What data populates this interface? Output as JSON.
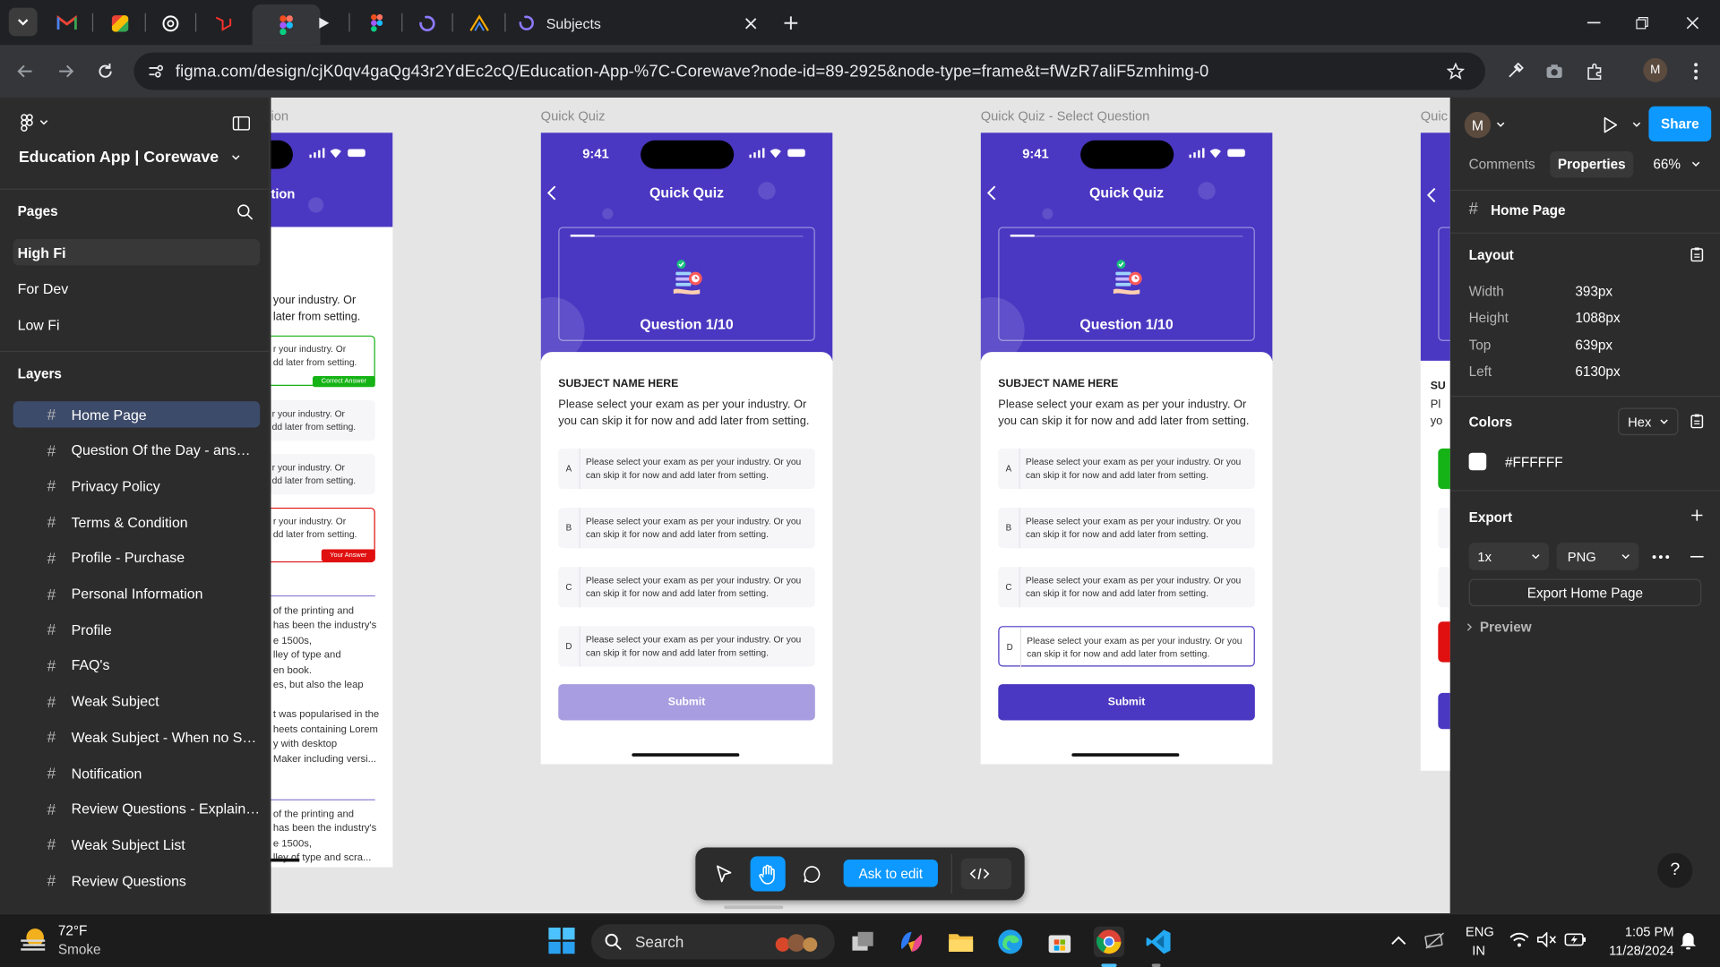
{
  "browser": {
    "active_tab_title": "Subjects",
    "url": "figma.com/design/cjK0qv4gaQg43r2YdEc2cQ/Education-App-%7C-Corewave?node-id=89-2925&node-type=frame&t=fWzR7aliF5zmhimg-0",
    "profile_initial": "M"
  },
  "left_panel": {
    "file_name": "Education App | Corewave",
    "pages_title": "Pages",
    "pages": [
      "High Fi",
      "For Dev",
      "Low Fi"
    ],
    "layers_title": "Layers",
    "layers": [
      "Home Page",
      "Question Of the Day - answer ...",
      "Privacy Policy",
      "Terms & Condition",
      "Profile - Purchase",
      "Personal Information",
      "Profile",
      "FAQ's",
      "Weak Subject",
      "Weak Subject - When no Subj...",
      "Notification",
      "Review Questions - Explainati...",
      "Weak Subject List",
      "Review Questions"
    ]
  },
  "canvas": {
    "partial_left_label": "ion",
    "partial_left_title": "tion",
    "partial_left": {
      "line1": "your industry. Or",
      "line2": "later from setting.",
      "card_a1": "r your industry. Or",
      "card_a2": "dd later from setting.",
      "correct": "Correct Answer",
      "card_b1": "r your industry. Or",
      "card_b2": "dd later from setting.",
      "card_c1": "r your industry. Or",
      "card_c2": "dd later from setting.",
      "card_d1": "r your industry. Or",
      "card_d2": "dd later from setting.",
      "your_answer": "Your Answer",
      "p1": "of the printing and",
      "p2": "has been the industry's",
      "p3": "e 1500s,",
      "p4": "lley of type and",
      "p5": "en book.",
      "p6": "es, but also the leap",
      "p7": "t was popularised in the",
      "p8": "heets containing Lorem",
      "p9": "y with desktop",
      "p10": "Maker including versi...",
      "p11": "of the printing and",
      "p12": "has been the industry's",
      "p13": "e 1500s,",
      "p14": "lley of type and scra..."
    },
    "frame1_label": "Quick Quiz",
    "frame2_label": "Quick Quiz - Select Question",
    "frame3_label": "Quic",
    "frame3_text1": "SU",
    "frame3_text2": "Pl",
    "frame3_text3": "yo",
    "phone": {
      "time": "9:41",
      "title": "Quick Quiz",
      "question_label": "Question 1/10",
      "subject": "SUBJECT NAME HERE",
      "description": "Please select your exam as per your industry. Or you can skip it for now and add later from setting.",
      "options": [
        {
          "letter": "A",
          "text": "Please select your exam as per your industry. Or you can skip it for now and add later from setting."
        },
        {
          "letter": "B",
          "text": "Please select your exam as per your industry. Or you can skip it for now and add later from setting."
        },
        {
          "letter": "C",
          "text": "Please select your exam as per your industry. Or you can skip it for now and add later from setting."
        },
        {
          "letter": "D",
          "text": "Please select your exam as per your industry. Or you can skip it for now and add later from setting."
        }
      ],
      "submit": "Submit"
    },
    "toolbar": {
      "ask_to_edit": "Ask to edit"
    }
  },
  "right_panel": {
    "avatar": "M",
    "share": "Share",
    "tab_comments": "Comments",
    "tab_properties": "Properties",
    "zoom": "66%",
    "frame_name": "Home Page",
    "layout_title": "Layout",
    "width_label": "Width",
    "width_value": "393px",
    "height_label": "Height",
    "height_value": "1088px",
    "top_label": "Top",
    "top_value": "639px",
    "left_label": "Left",
    "left_value": "6130px",
    "colors_title": "Colors",
    "color_format": "Hex",
    "color_value": "#FFFFFF",
    "export_title": "Export",
    "export_scale": "1x",
    "export_format": "PNG",
    "export_button": "Export Home Page",
    "preview": "Preview",
    "help": "?"
  },
  "taskbar": {
    "weather_temp": "72°F",
    "weather_desc": "Smoke",
    "search": "Search",
    "lang_1": "ENG",
    "lang_2": "IN",
    "time": "1:05 PM",
    "date": "11/28/2024"
  },
  "colors": {
    "brand_purple": "#4a38c2",
    "figma_blue": "#0d99ff",
    "submit_disabled": "#a79de0",
    "correct_green": "#16b316",
    "wrong_red": "#e01010"
  }
}
